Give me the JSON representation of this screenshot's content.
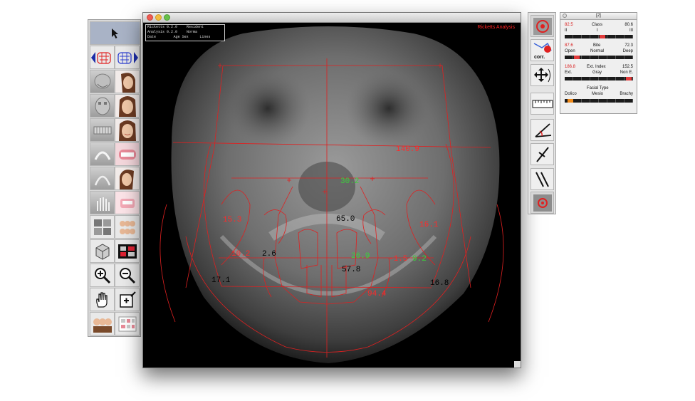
{
  "main_window": {
    "info_box": {
      "rows": [
        [
          "Ricketts 0.2.0",
          "Resident"
        ],
        [
          "Analysis 0.2.0",
          "Norma"
        ],
        [
          "Date",
          "Age Sex",
          "Lines"
        ]
      ]
    },
    "analysis_title": "Ricketts Analysis",
    "measurements": {
      "width_top": "140.9",
      "nasal": "30.2",
      "left_ramus": "15.3",
      "right_ramus": "16.1",
      "center_upper": "65.0",
      "left_mid": "10.2",
      "left_small": "2.6",
      "center_green": "26.9",
      "right_pair_red": "-1.5",
      "right_pair_green": "9.2",
      "center_lower": "57.8",
      "left_lower": "17.1",
      "right_lower": "16.8",
      "bottom_center": "94.4"
    },
    "colors": {
      "red_line": "#e02020",
      "red_text": "#ff2a2a",
      "green_text": "#3bd03b",
      "black_text": "#000000"
    }
  },
  "left_palette": {
    "tools": [
      {
        "name": "pointer-tool",
        "icon": "arrow-pointer-icon"
      },
      {
        "name": "prev-view-tool",
        "icon": "chevron-left-icon"
      },
      {
        "name": "next-view-tool",
        "icon": "chevron-right-icon"
      },
      {
        "name": "zoom-in-tool",
        "icon": "zoom-in-icon"
      },
      {
        "name": "zoom-out-tool",
        "icon": "zoom-out-icon"
      },
      {
        "name": "hand-tool",
        "icon": "hand-icon"
      },
      {
        "name": "add-point-tool",
        "icon": "add-point-icon"
      }
    ]
  },
  "tool_strip": {
    "buttons": [
      "target-icon",
      "corr-icon",
      "move-icon",
      "ruler-icon",
      "angle-icon",
      "line-icon",
      "parallel-lines-icon",
      "target-small-icon"
    ],
    "corr_label": "corr."
  },
  "analysis_panel": {
    "title": "[2]",
    "class": {
      "left_value": "82.5",
      "label": "Class",
      "right_value": "80.6",
      "ticks": [
        "II",
        "I",
        "III"
      ],
      "level": 0.55
    },
    "bite": {
      "left_value": "87.6",
      "label": "Bite",
      "right_value": "72.3",
      "ticks": [
        "Open",
        "Normal",
        "Deep"
      ],
      "level": 0.18
    },
    "ext_index": {
      "left_value": "186.8",
      "label": "Ext. Index",
      "right_value": "152.5",
      "ticks": [
        "Ext.",
        "Gray",
        "Non E."
      ],
      "level": 0.94
    },
    "facial_type": {
      "label": "Facial Type",
      "ticks": [
        "Dolico",
        "Mesio",
        "Brachy"
      ],
      "level": 0.08
    }
  }
}
